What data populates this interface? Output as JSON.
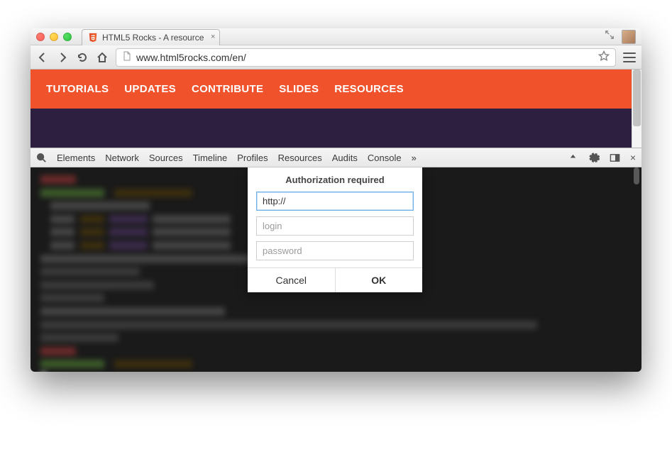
{
  "window": {
    "tab_title": "HTML5 Rocks - A resource",
    "url": "www.html5rocks.com/en/"
  },
  "nav": {
    "items": [
      "TUTORIALS",
      "UPDATES",
      "CONTRIBUTE",
      "SLIDES",
      "RESOURCES"
    ]
  },
  "devtools": {
    "tabs": [
      "Elements",
      "Network",
      "Sources",
      "Timeline",
      "Profiles",
      "Resources",
      "Audits",
      "Console"
    ],
    "overflow": "»"
  },
  "dialog": {
    "title": "Authorization required",
    "url_value": "http://",
    "login_placeholder": "login",
    "password_placeholder": "password",
    "cancel": "Cancel",
    "ok": "OK"
  }
}
